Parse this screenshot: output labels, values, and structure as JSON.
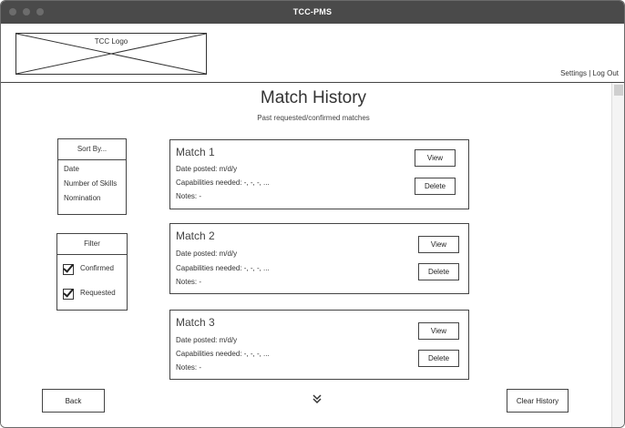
{
  "window": {
    "title": "TCC-PMS"
  },
  "header": {
    "logo_text": "TCC Logo",
    "settings_label": "Settings",
    "separator": " | ",
    "logout_label": "Log Out"
  },
  "page": {
    "title": "Match History",
    "subtitle": "Past requested/confirmed matches"
  },
  "sort": {
    "heading": "Sort By...",
    "options": [
      "Date",
      "Number of Skills",
      "Nomination"
    ]
  },
  "filter": {
    "heading": "Filter",
    "options": [
      {
        "label": "Confirmed",
        "checked": true
      },
      {
        "label": "Requested",
        "checked": true
      }
    ]
  },
  "matches": [
    {
      "title": "Match 1",
      "date": "Date posted: m/d/y",
      "capabilities": "Capabilities needed: -, -, -, ...",
      "notes": "Notes: -",
      "view_label": "View",
      "delete_label": "Delete"
    },
    {
      "title": "Match 2",
      "date": "Date posted: m/d/y",
      "capabilities": "Capabilities needed: -, -, -, ...",
      "notes": "Notes: -",
      "view_label": "View",
      "delete_label": "Delete"
    },
    {
      "title": "Match 3",
      "date": "Date posted: m/d/y",
      "capabilities": "Capabilities needed: -, -, -, ...",
      "notes": "Notes: -",
      "view_label": "View",
      "delete_label": "Delete"
    }
  ],
  "footer": {
    "back_label": "Back",
    "clear_label": "Clear History",
    "more_icon": "double-chevron-down-icon"
  }
}
